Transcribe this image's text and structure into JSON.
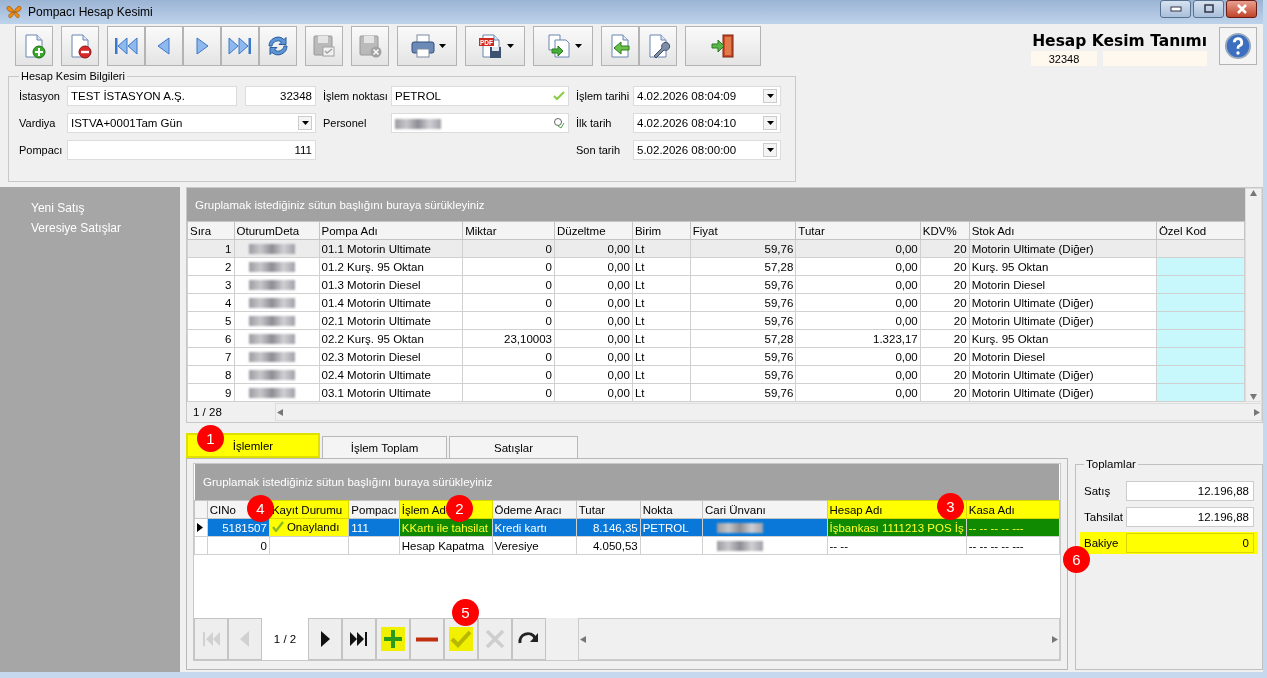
{
  "window": {
    "title": "Pompacı Hesap Kesimi"
  },
  "toolbar": [
    {
      "kind": "new",
      "disabled": false,
      "menu": false
    },
    {
      "kind": "delete",
      "disabled": false,
      "menu": false
    },
    {
      "kind": "first",
      "disabled": false,
      "menu": false
    },
    {
      "kind": "prev",
      "disabled": false,
      "menu": false
    },
    {
      "kind": "next",
      "disabled": false,
      "menu": false
    },
    {
      "kind": "last",
      "disabled": false,
      "menu": false
    },
    {
      "kind": "refresh",
      "disabled": false,
      "menu": false
    },
    {
      "kind": "save",
      "disabled": true,
      "menu": false
    },
    {
      "kind": "cancel",
      "disabled": true,
      "menu": false
    },
    {
      "kind": "print",
      "disabled": false,
      "menu": true
    },
    {
      "kind": "pdf",
      "label": "PDF",
      "disabled": false,
      "menu": true
    },
    {
      "kind": "copy",
      "disabled": false,
      "menu": true
    },
    {
      "kind": "import",
      "disabled": false,
      "menu": false
    },
    {
      "kind": "tools",
      "disabled": false,
      "menu": false
    },
    {
      "kind": "exit",
      "disabled": false,
      "menu": false
    }
  ],
  "header": {
    "title": "Hesap Kesim Tanımı",
    "code": "32348"
  },
  "info": {
    "title": "Hesap Kesim Bilgileri",
    "left": [
      {
        "label": "İstasyon",
        "kind": "text",
        "value": "TEST İSTASYON A.Ş.",
        "code": "32348"
      },
      {
        "label": "Vardiya",
        "kind": "combo",
        "value": "ISTVA+0001Tam Gün"
      },
      {
        "label": "Pompacı",
        "kind": "number",
        "value": "111"
      }
    ],
    "middle": [
      {
        "label": "İşlem noktası",
        "kind": "lookup",
        "value": "PETROL",
        "blurred": false
      },
      {
        "label": "Personel",
        "kind": "lookup",
        "blurred": true
      }
    ],
    "right": [
      {
        "label": "İşlem tarihi",
        "kind": "combo",
        "value": "4.02.2026 08:04:09"
      },
      {
        "label": "İlk tarih",
        "kind": "combo",
        "value": "4.02.2026 08:04:10"
      },
      {
        "label": "Son tarih",
        "kind": "combo",
        "value": "5.02.2026 08:00:00"
      }
    ]
  },
  "sidebar": {
    "items": [
      "Yeni Satış",
      "Veresiye Satışlar"
    ]
  },
  "grid": {
    "group_hint": "Gruplamak istediğiniz sütun başlığını buraya sürükleyiniz",
    "columns": [
      {
        "title": "Sıra",
        "kind": "text"
      },
      {
        "title": "OturumDeta",
        "kind": "blurred"
      },
      {
        "title": "Pompa Adı",
        "kind": "text"
      },
      {
        "title": "Miktar",
        "kind": "text"
      },
      {
        "title": "Düzeltme",
        "kind": "text"
      },
      {
        "title": "Birim",
        "kind": "text"
      },
      {
        "title": "Fiyat",
        "kind": "text"
      },
      {
        "title": "Tutar",
        "kind": "text"
      },
      {
        "title": "KDV%",
        "kind": "text"
      },
      {
        "title": "Stok Adı",
        "kind": "text"
      },
      {
        "title": "Özel Kod",
        "kind": "code"
      }
    ],
    "rows": [
      {
        "selected": true,
        "cells": [
          "1",
          null,
          "01.1 Motorin Ultimate",
          "0",
          "0,00",
          "Lt",
          "59,76",
          "0,00",
          "20",
          "Motorin Ultimate (Diğer)",
          null
        ]
      },
      {
        "selected": false,
        "cells": [
          "2",
          null,
          "01.2 Kurş. 95 Oktan",
          "0",
          "0,00",
          "Lt",
          "57,28",
          "0,00",
          "20",
          "Kurş. 95 Oktan",
          null
        ]
      },
      {
        "selected": false,
        "cells": [
          "3",
          null,
          "01.3 Motorin Diesel",
          "0",
          "0,00",
          "Lt",
          "59,76",
          "0,00",
          "20",
          "Motorin Diesel",
          null
        ]
      },
      {
        "selected": false,
        "cells": [
          "4",
          null,
          "01.4 Motorin Ultimate",
          "0",
          "0,00",
          "Lt",
          "59,76",
          "0,00",
          "20",
          "Motorin Ultimate (Diğer)",
          null
        ]
      },
      {
        "selected": false,
        "cells": [
          "5",
          null,
          "02.1 Motorin Ultimate",
          "0",
          "0,00",
          "Lt",
          "59,76",
          "0,00",
          "20",
          "Motorin Ultimate (Diğer)",
          null
        ]
      },
      {
        "selected": false,
        "cells": [
          "6",
          null,
          "02.2 Kurş. 95 Oktan",
          "23,10003",
          "0,00",
          "Lt",
          "57,28",
          "1.323,17",
          "20",
          "Kurş. 95 Oktan",
          null
        ]
      },
      {
        "selected": false,
        "cells": [
          "7",
          null,
          "02.3 Motorin Diesel",
          "0",
          "0,00",
          "Lt",
          "59,76",
          "0,00",
          "20",
          "Motorin Diesel",
          null
        ]
      },
      {
        "selected": false,
        "cells": [
          "8",
          null,
          "02.4 Motorin Ultimate",
          "0",
          "0,00",
          "Lt",
          "59,76",
          "0,00",
          "20",
          "Motorin Ultimate (Diğer)",
          null
        ]
      },
      {
        "selected": false,
        "cells": [
          "9",
          null,
          "03.1 Motorin Ultimate",
          "0",
          "0,00",
          "Lt",
          "59,76",
          "0,00",
          "20",
          "Motorin Ultimate (Diğer)",
          null
        ]
      }
    ],
    "pager": "1 / 28"
  },
  "tabs": [
    {
      "label": "İşlemler",
      "selected": true,
      "highlighted": true
    },
    {
      "label": "İşlem Toplam",
      "selected": false,
      "highlighted": false
    },
    {
      "label": "Satışlar",
      "selected": false,
      "highlighted": false
    }
  ],
  "operations": {
    "group_hint": "Gruplamak istediğiniz sütun başlığını buraya sürükleyiniz",
    "columns": [
      {
        "title": "CINo",
        "kind": "text",
        "highlighted": false
      },
      {
        "title": "Kayıt Durumu",
        "kind": "status",
        "highlighted": true
      },
      {
        "title": "Pompacı",
        "kind": "text",
        "highlighted": false
      },
      {
        "title": "İşlem Adı",
        "kind": "text",
        "highlighted": true
      },
      {
        "title": "Ödeme Aracı",
        "kind": "text",
        "highlighted": false
      },
      {
        "title": "Tutar",
        "kind": "text",
        "highlighted": false
      },
      {
        "title": "Nokta",
        "kind": "text",
        "highlighted": false
      },
      {
        "title": "Cari Ünvanı",
        "kind": "blurred",
        "highlighted": false
      },
      {
        "title": "Hesap Adı",
        "kind": "text",
        "highlighted": true
      },
      {
        "title": "Kasa Adı",
        "kind": "text",
        "highlighted": true
      }
    ],
    "rows": [
      {
        "selected": true,
        "cells": [
          "5181507",
          "Onaylandı",
          "111",
          "KKartı ile tahsilat",
          "Kredi kartı",
          "8.146,35",
          "PETROL",
          null,
          "İşbankası 1111213 POS İş",
          "-- -- -- -- ---"
        ]
      },
      {
        "selected": false,
        "cells": [
          "0",
          null,
          null,
          "Hesap Kapatma",
          "Veresiye",
          "4.050,53",
          null,
          null,
          "-- --",
          "-- -- -- -- ---"
        ]
      }
    ],
    "navigator": {
      "page": "1 / 2",
      "buttons": [
        {
          "kind": "first",
          "disabled": true,
          "highlighted": false
        },
        {
          "kind": "prev",
          "disabled": true,
          "highlighted": false
        },
        {
          "kind": "next",
          "disabled": false,
          "highlighted": false
        },
        {
          "kind": "last",
          "disabled": false,
          "highlighted": false
        },
        {
          "kind": "add",
          "disabled": false,
          "highlighted": true
        },
        {
          "kind": "remove",
          "disabled": false,
          "highlighted": false
        },
        {
          "kind": "confirm",
          "disabled": false,
          "highlighted": true
        },
        {
          "kind": "cancel",
          "disabled": true,
          "highlighted": false
        },
        {
          "kind": "redo",
          "disabled": false,
          "highlighted": false
        }
      ]
    }
  },
  "totals": {
    "title": "Toplamlar",
    "rows": [
      {
        "label": "Satış",
        "value": "12.196,88",
        "highlighted": false
      },
      {
        "label": "Tahsilat",
        "value": "12.196,88",
        "highlighted": false
      },
      {
        "label": "Bakiye",
        "value": "0",
        "highlighted": true
      }
    ]
  },
  "markers": [
    "1",
    "4",
    "2",
    "3",
    "6",
    "5"
  ]
}
